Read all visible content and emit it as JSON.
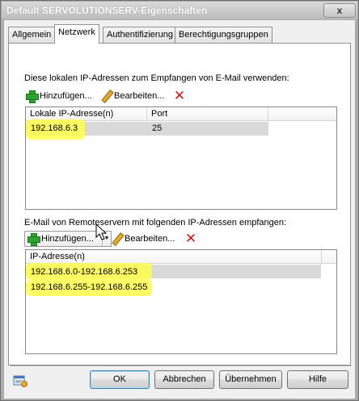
{
  "window": {
    "title": "Default SERVOLUTIONSERV-Eigenschaften",
    "close_label": "x"
  },
  "tabs": [
    {
      "label": "Allgemein"
    },
    {
      "label": "Netzwerk"
    },
    {
      "label": "Authentifizierung"
    },
    {
      "label": "Berechtigungsgruppen"
    }
  ],
  "local_section": {
    "label": "Diese lokalen IP-Adressen zum Empfangen von E-Mail verwenden:",
    "add_label": "Hinzufügen...",
    "edit_label": "Bearbeiten...",
    "columns": [
      "Lokale IP-Adresse(n)",
      "Port"
    ],
    "rows": [
      {
        "ip": "192.168.6.3",
        "port": "25"
      }
    ]
  },
  "remote_section": {
    "label": "E-Mail von Remoteservern mit folgenden IP-Adressen empfangen:",
    "add_label": "Hinzufügen...",
    "edit_label": "Bearbeiten...",
    "columns": [
      "IP-Adresse(n)"
    ],
    "rows": [
      {
        "ip": "192.168.6.0-192.168.6.253"
      },
      {
        "ip": "192.168.6.255-192.168.6.255"
      }
    ]
  },
  "footer": {
    "ok_label": "OK",
    "cancel_label": "Abbrechen",
    "apply_label": "Übernehmen",
    "help_label": "Hilfe"
  },
  "colors": {
    "highlight": "#ffff4a",
    "selection": "#d9d9d9",
    "delete_icon": "#d01818",
    "add_icon": "#2fa12f"
  }
}
